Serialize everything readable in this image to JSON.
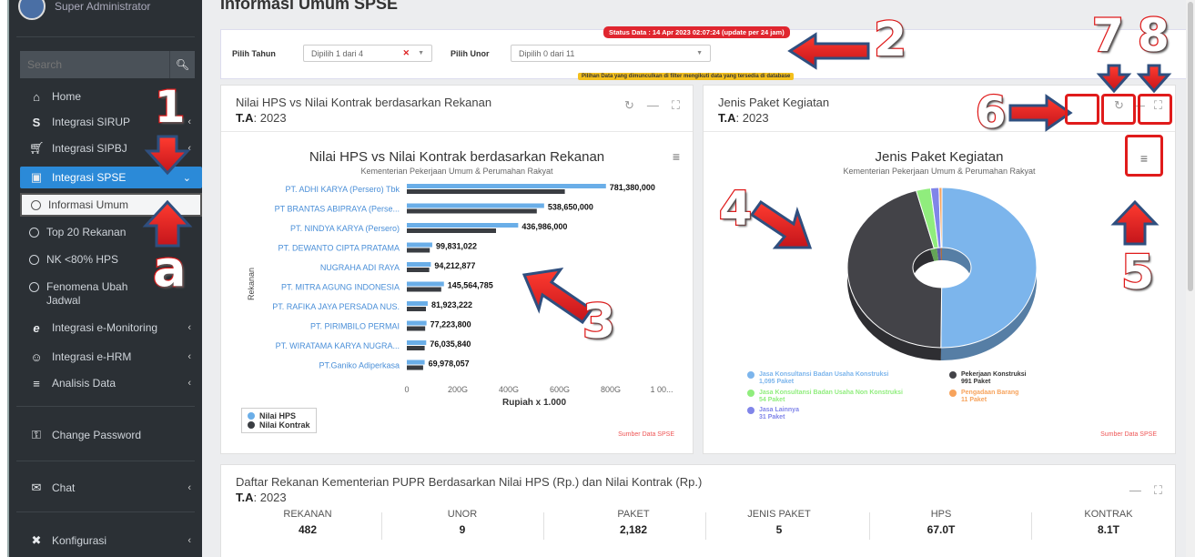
{
  "sidebar": {
    "user": "Super Administrator",
    "search_placeholder": "Search",
    "items": [
      {
        "label": "Home",
        "icon": "home-icon"
      },
      {
        "label": "Integrasi SIRUP",
        "icon": "dollar-icon"
      },
      {
        "label": "Integrasi SIPBJ",
        "icon": "cart-icon"
      },
      {
        "label": "Integrasi SPSE",
        "icon": "shopping-bag-icon"
      },
      {
        "label": "Integrasi e-Monitoring",
        "icon": "ie-icon"
      },
      {
        "label": "Integrasi e-HRM",
        "icon": "users-icon"
      },
      {
        "label": "Analisis Data",
        "icon": "database-icon"
      },
      {
        "label": "Change Password",
        "icon": "key-icon"
      },
      {
        "label": "Chat",
        "icon": "chat-icon"
      },
      {
        "label": "Konfigurasi",
        "icon": "wrench-icon"
      }
    ],
    "sub_items": [
      {
        "label": "Informasi Umum"
      },
      {
        "label": "Top 20 Rekanan"
      },
      {
        "label": "NK <80% HPS"
      },
      {
        "label": "Fenomena Ubah Jadwal"
      }
    ]
  },
  "page": {
    "title": "Informasi Umum SPSE"
  },
  "filters": {
    "status": "Status Data : 14 Apr 2023 02:07:24 (update per 24 jam)",
    "tahun_label": "Pilih Tahun",
    "tahun_value": "Dipilih 1 dari 4",
    "unor_label": "Pilih Unor",
    "unor_value": "Dipilih 0 dari 11",
    "note": "Pilihan Data yang dimunculkan di filter mengikuti data yang tersedia di database"
  },
  "card_left": {
    "title": "Nilai HPS vs Nilai Kontrak berdasarkan Rekanan",
    "ta_label": "T.A",
    "ta_value": ": 2023",
    "chart_title": "Nilai HPS vs Nilai Kontrak berdasarkan Rekanan",
    "chart_subtitle": "Kementerian Pekerjaan Umum & Perumahan Rakyat",
    "source": "Sumber Data SPSE"
  },
  "card_right": {
    "title": "Jenis Paket Kegiatan",
    "ta_label": "T.A",
    "ta_value": ": 2023",
    "chart_title": "Jenis Paket Kegiatan",
    "chart_subtitle": "Kementerian Pekerjaan Umum & Perumahan Rakyat",
    "source": "Sumber Data SPSE"
  },
  "card_bottom": {
    "title": "Daftar Rekanan Kementerian PUPR Berdasarkan Nilai HPS (Rp.) dan Nilai Kontrak (Rp.)",
    "ta_label": "T.A",
    "ta_value": ": 2023",
    "summary": [
      {
        "label": "REKANAN",
        "value": "482"
      },
      {
        "label": "UNOR",
        "value": "9"
      },
      {
        "label": "PAKET",
        "value": "2,182"
      },
      {
        "label": "JENIS PAKET",
        "value": "5"
      },
      {
        "label": "HPS",
        "value": "67.0T"
      },
      {
        "label": "KONTRAK",
        "value": "8.1T"
      }
    ]
  },
  "annotations": [
    "1",
    "a",
    "2",
    "3",
    "4",
    "5",
    "6",
    "7",
    "8"
  ],
  "colors": {
    "accent": "#2b8ad8",
    "hps": "#6aaee8",
    "kontrak": "#3a3d42",
    "annotation": "#e01b1b"
  },
  "chart_data": [
    {
      "type": "bar",
      "orientation": "horizontal",
      "categories": [
        "PT. ADHI KARYA (Persero) Tbk",
        "PT BRANTAS ABIPRAYA (Perse...",
        "PT. NINDYA KARYA (Persero)",
        "PT. DEWANTO CIPTA PRATAMA",
        "NUGRAHA ADI RAYA",
        "PT. MITRA AGUNG INDONESIA",
        "PT. RAFIKA JAYA PERSADA NUS.",
        "PT. PIRIMBILO PERMAI",
        "PT. WIRATAMA KARYA NUGRA...",
        "PT.Ganiko Adiperkasa"
      ],
      "series": [
        {
          "name": "Nilai HPS",
          "values": [
            781380000,
            538650000,
            436986000,
            99831022,
            94212877,
            145564785,
            81923222,
            77223800,
            76035840,
            69978057
          ]
        },
        {
          "name": "Nilai Kontrak",
          "values": [
            620000000,
            510000000,
            350000000,
            90000000,
            88000000,
            135000000,
            75000000,
            72000000,
            70000000,
            64000000
          ]
        }
      ],
      "data_labels": [
        "781,380,000",
        "538,650,000",
        "436,986,000",
        "99,831,022",
        "94,212,877",
        "145,564,785",
        "81,923,222",
        "77,223,800",
        "76,035,840",
        "69,978,057"
      ],
      "xlabel": "Rupiah x 1.000",
      "ylabel": "Rekanan",
      "xticks": [
        "0",
        "200G",
        "400G",
        "600G",
        "800G",
        "1 00..."
      ],
      "xlim": [
        0,
        1000000000
      ]
    },
    {
      "type": "pie",
      "variant": "3d-donut",
      "slices": [
        {
          "label": "Jasa Konsultansi Badan Usaha Konstruksi",
          "value": 1095,
          "text": "1,095 Paket",
          "color": "#7cb5ec"
        },
        {
          "label": "Pekerjaan Konstruksi",
          "value": 991,
          "text": "991 Paket",
          "color": "#434348"
        },
        {
          "label": "Jasa Konsultansi Badan Usaha Non Konstruksi",
          "value": 54,
          "text": "54 Paket",
          "color": "#90ed7d"
        },
        {
          "label": "Pengadaan Barang",
          "value": 11,
          "text": "11 Paket",
          "color": "#f7a35c"
        },
        {
          "label": "Jasa Lainnya",
          "value": 31,
          "text": "31 Paket",
          "color": "#8085e9"
        }
      ]
    }
  ]
}
